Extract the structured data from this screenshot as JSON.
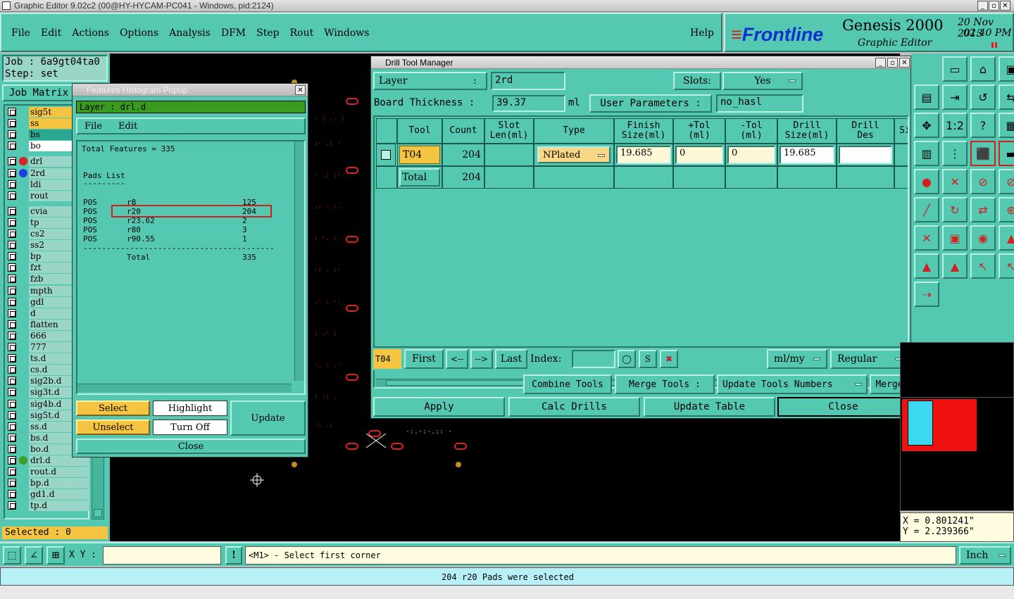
{
  "app_title": "Graphic Editor 9.02c2 (00@HY-HYCAM-PC041 - Windows, pid:2124)",
  "menu": [
    "File",
    "Edit",
    "Actions",
    "Options",
    "Analysis",
    "DFM",
    "Step",
    "Rout",
    "Windows"
  ],
  "help": "Help",
  "brand": {
    "logo": "Frontline",
    "product": "Genesis 2000",
    "subtitle": "Graphic Editor",
    "date": "20 Nov 2013",
    "time": "02:40 PM"
  },
  "job": {
    "label": "Job : 6a9gt04ta0",
    "step": "Step: set",
    "matrix": "Job Matrix"
  },
  "layers": [
    {
      "name": "sig5t",
      "color": "#f5c542"
    },
    {
      "name": "ss",
      "color": "#f5c542"
    },
    {
      "name": "bs",
      "color": "#2aa890"
    },
    {
      "name": "bo",
      "color": "#ffffff"
    },
    {
      "name": "drl",
      "color": "#9ad6c8",
      "dot": "#e02020"
    },
    {
      "name": "2rd",
      "color": "#9ad6c8",
      "dot": "#2040e0"
    },
    {
      "name": "ldi",
      "color": "#9ad6c8"
    },
    {
      "name": "rout",
      "color": "#9ad6c8"
    },
    {
      "name": "cvia",
      "color": "#9ad6c8"
    },
    {
      "name": "tp",
      "color": "#9ad6c8"
    },
    {
      "name": "cs2",
      "color": "#9ad6c8"
    },
    {
      "name": "ss2",
      "color": "#9ad6c8"
    },
    {
      "name": "bp",
      "color": "#9ad6c8"
    },
    {
      "name": "fzt",
      "color": "#9ad6c8"
    },
    {
      "name": "fzb",
      "color": "#9ad6c8"
    },
    {
      "name": "mpth",
      "color": "#9ad6c8"
    },
    {
      "name": "gdl",
      "color": "#9ad6c8"
    },
    {
      "name": "d",
      "color": "#9ad6c8"
    },
    {
      "name": "flatten",
      "color": "#9ad6c8"
    },
    {
      "name": "666",
      "color": "#9ad6c8"
    },
    {
      "name": "777",
      "color": "#9ad6c8"
    },
    {
      "name": "ts.d",
      "color": "#9ad6c8"
    },
    {
      "name": "cs.d",
      "color": "#9ad6c8"
    },
    {
      "name": "sig2b.d",
      "color": "#9ad6c8"
    },
    {
      "name": "sig3t.d",
      "color": "#9ad6c8"
    },
    {
      "name": "sig4b.d",
      "color": "#9ad6c8"
    },
    {
      "name": "sig5t.d",
      "color": "#9ad6c8"
    },
    {
      "name": "ss.d",
      "color": "#9ad6c8"
    },
    {
      "name": "bs.d",
      "color": "#9ad6c8"
    },
    {
      "name": "bo.d",
      "color": "#9ad6c8"
    },
    {
      "name": "drl.d",
      "color": "#9ad6c8",
      "dot": "#3aa020"
    },
    {
      "name": "rout.d",
      "color": "#9ad6c8"
    },
    {
      "name": "bp.d",
      "color": "#9ad6c8"
    },
    {
      "name": "gd1.d",
      "color": "#9ad6c8"
    },
    {
      "name": "tp.d",
      "color": "#9ad6c8"
    }
  ],
  "selected": "Selected : 0",
  "histogram": {
    "title": "Features Histogram Popup",
    "layer": "Layer :  drl.d",
    "menu": [
      "File",
      "Edit"
    ],
    "total_features": "Total Features = 335",
    "pads_list": "Pads List",
    "underline": "---------",
    "rows": [
      {
        "pol": "POS",
        "sym": "r8",
        "count": "125"
      },
      {
        "pol": "POS",
        "sym": "r20",
        "count": "204"
      },
      {
        "pol": "POS",
        "sym": "r23.62",
        "count": "2"
      },
      {
        "pol": "POS",
        "sym": "r80",
        "count": "3"
      },
      {
        "pol": "POS",
        "sym": "r90.55",
        "count": "1"
      }
    ],
    "sep": "------------------------------------------------",
    "total_label": "Total",
    "total_value": "335",
    "buttons": {
      "select": "Select",
      "highlight": "Highlight",
      "update": "Update",
      "unselect": "Unselect",
      "turn_off": "Turn Off",
      "close": "Close"
    }
  },
  "dtm": {
    "title": "Drill Tool Manager",
    "layer_label": "Layer",
    "layer_colon": ":",
    "layer_value": "2rd",
    "slots_label": "Slots:",
    "slots_value": "Yes",
    "board_thickness_label": "Board Thickness :",
    "board_thickness_value": "39.37",
    "unit": "ml",
    "user_params_label": "User Parameters :",
    "user_params_value": "no_hasl",
    "headers": [
      "Tool",
      "Count",
      "Slot\nLen(ml)",
      "Type",
      "Finish\nSize(ml)",
      "+Tol\n(ml)",
      "-Tol\n(ml)",
      "Drill\nSize(ml)",
      "Drill\nDes",
      "Si"
    ],
    "row": {
      "tool": "T04",
      "count": "204",
      "type": "NPlated",
      "finish": "19.685",
      "ptol": "0",
      "mtol": "0",
      "drill": "19.685",
      "des": ""
    },
    "total": {
      "label": "Total",
      "count": "204"
    },
    "nav": {
      "current": "T04",
      "first": "First",
      "prev": "<--",
      "next": "-->",
      "last": "Last",
      "index_label": "Index:",
      "units": "ml/my",
      "mode": "Regular"
    },
    "actions": {
      "combine": "Combine Tools",
      "merge_label": "Merge Tools :",
      "update_numbers": "Update Tools Numbers",
      "merge": "Merge"
    },
    "bottom": {
      "apply": "Apply",
      "calc": "Calc Drills",
      "update_table": "Update Table",
      "close": "Close"
    }
  },
  "coords": {
    "x": "X = 0.801241\"",
    "y": "Y = 2.239366\""
  },
  "status": {
    "xy_label": "X Y :",
    "prompt": "<M1> - Select first corner",
    "units": "Inch",
    "message": "204 r20 Pads were selected"
  },
  "tool_icons": [
    "display-icon",
    "home-icon",
    "panel-icon",
    "frame-icon",
    "export-icon",
    "snap-icon",
    "swap-icon",
    "move-icon",
    "zoom-fit-icon",
    "scale-icon",
    "help-icon",
    "grid-icon",
    "layers-icon",
    "layers2-icon",
    "ruler-icon",
    "pad-icon",
    "cut-icon",
    "measure-icon",
    "measure2-icon",
    "line-icon",
    "rotate-icon",
    "flip-icon",
    "connect-icon",
    "cross-icon",
    "array-icon",
    "shape-icon",
    "arc-icon",
    "arc2-icon",
    "arc3-icon",
    "pointer-icon",
    "pointer2-icon",
    "net-icon"
  ]
}
